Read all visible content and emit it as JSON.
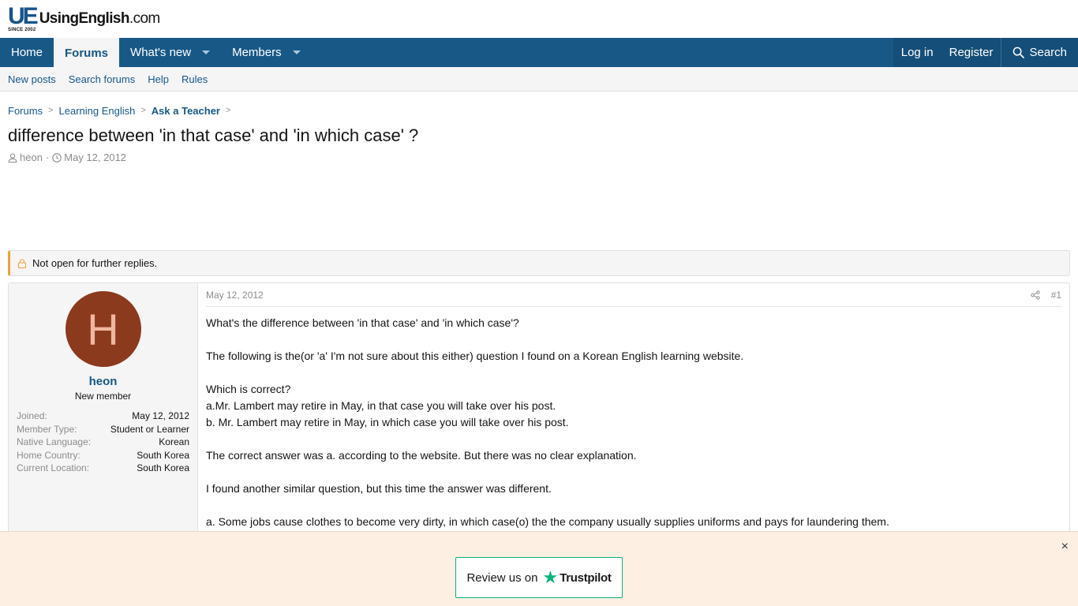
{
  "logo": {
    "mark": "UE",
    "name": "UsingEnglish",
    "tld": ".com",
    "since": "SINCE 2002"
  },
  "nav": {
    "tabs": [
      {
        "label": "Home"
      },
      {
        "label": "Forums"
      },
      {
        "label": "What's new"
      },
      {
        "label": "Members"
      }
    ],
    "login": "Log in",
    "register": "Register",
    "search": "Search"
  },
  "subnav": [
    "New posts",
    "Search forums",
    "Help",
    "Rules"
  ],
  "breadcrumb": [
    "Forums",
    "Learning English",
    "Ask a Teacher"
  ],
  "thread": {
    "title": "difference between 'in that case' and 'in which case' ?",
    "author": "heon",
    "date": "May 12, 2012"
  },
  "notice": "Not open for further replies.",
  "post": {
    "date": "May 12, 2012",
    "number": "#1",
    "user": {
      "avatar_letter": "H",
      "name": "heon",
      "title": "New member",
      "extras": [
        {
          "label": "Joined:",
          "value": "May 12, 2012"
        },
        {
          "label": "Member Type:",
          "value": "Student or Learner"
        },
        {
          "label": "Native Language:",
          "value": "Korean"
        },
        {
          "label": "Home Country:",
          "value": "South Korea"
        },
        {
          "label": "Current Location:",
          "value": "South Korea"
        }
      ]
    },
    "body": {
      "p1": "What's the difference between 'in that case' and 'in which case'?",
      "p2": "The following is the(or 'a' I'm not sure about this either) question I found on a Korean English learning website.",
      "p3a": "Which is correct?",
      "p3b": "a.Mr. Lambert may retire in May, in that case you will take over his post.",
      "p3c": "b. Mr. Lambert may retire in May, in which case you will take over his post.",
      "p4": "The correct answer was a. according to the website. But there was no clear explanation.",
      "p5": "I found another similar question, but this time the answer was different.",
      "p6": "a. Some jobs cause clothes to become very dirty, in which case(o) the the company usually supplies uniforms and pays for laundering them."
    }
  },
  "trustpilot": {
    "review": "Review us on",
    "brand": "Trustpilot",
    "close": "×"
  },
  "colors": {
    "nav": "#185886",
    "accent": "#e8a33b",
    "avatar": "#8b3a1e",
    "trustpilot": "#00b67a"
  }
}
